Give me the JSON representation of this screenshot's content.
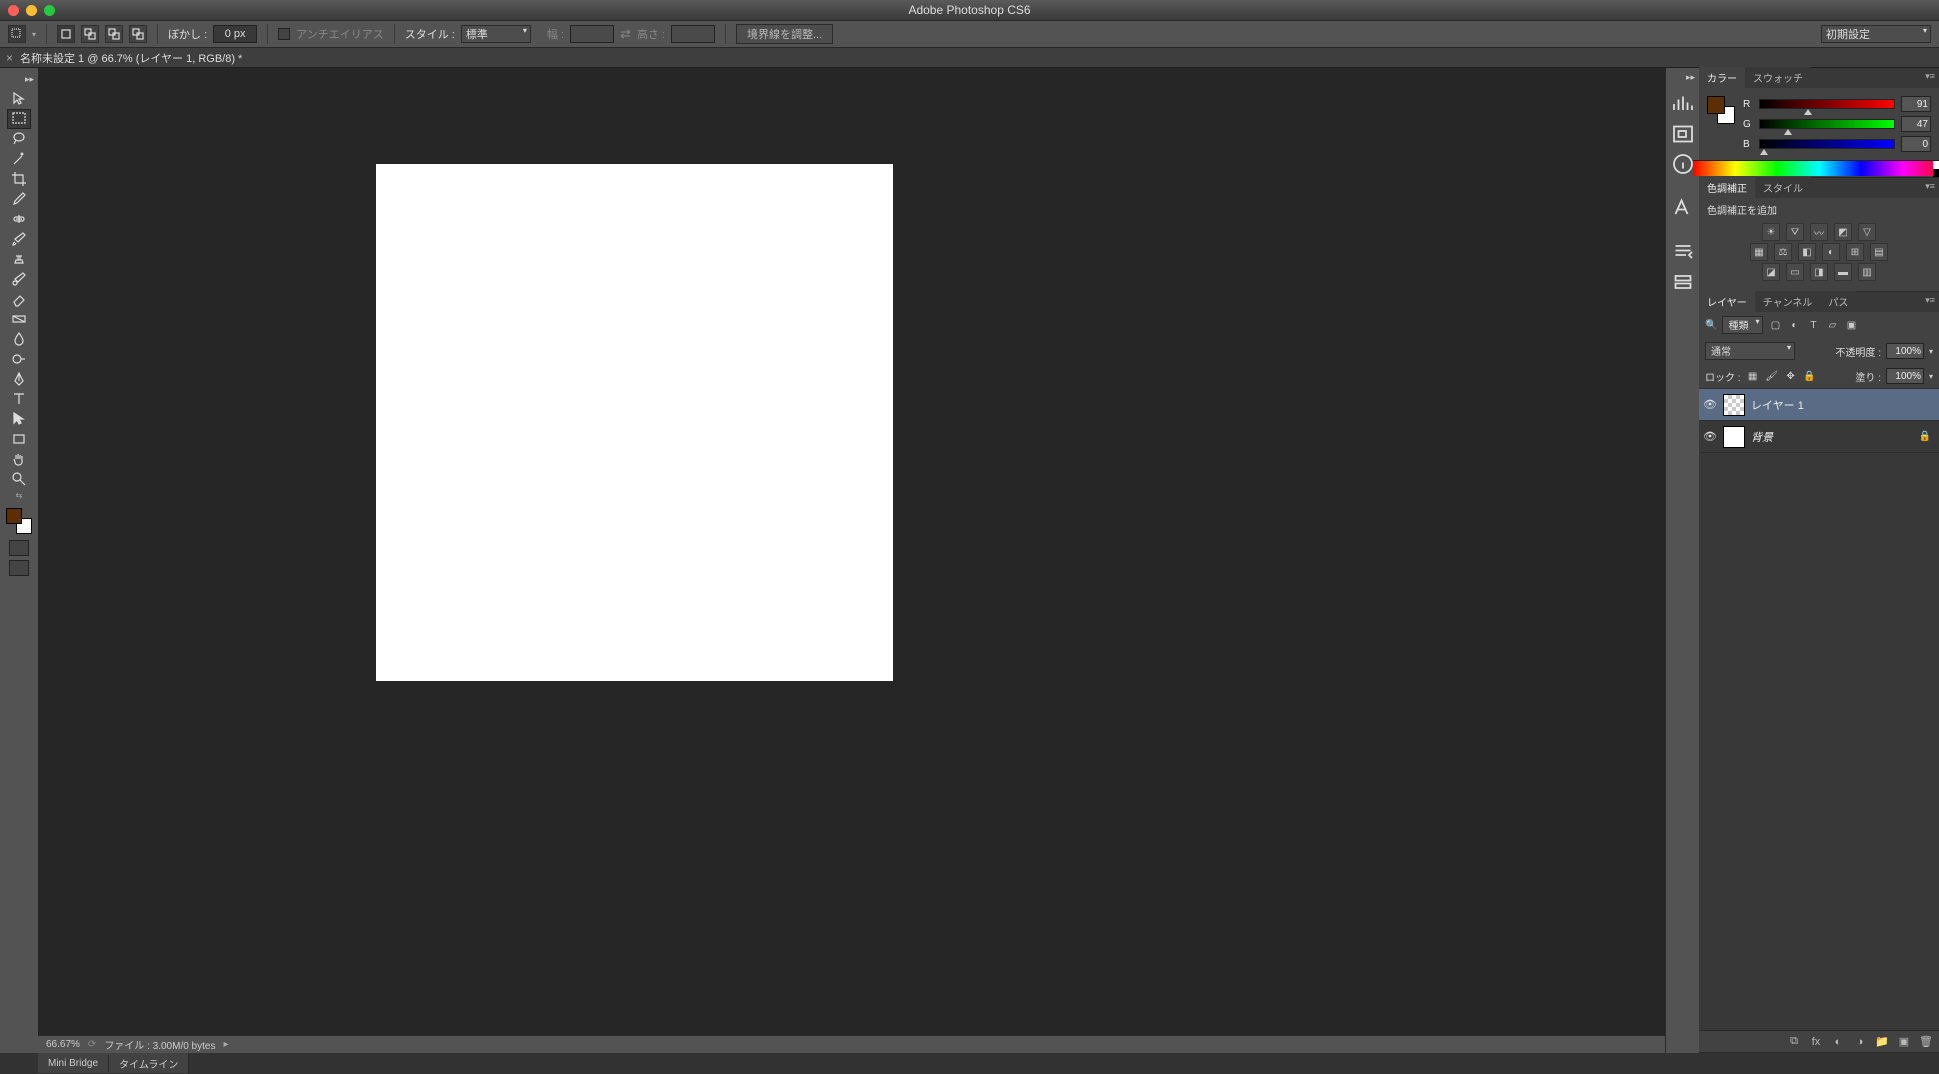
{
  "app_title": "Adobe Photoshop CS6",
  "workspace": "初期設定",
  "options_bar": {
    "feather_label": "ぼかし :",
    "feather_value": "0 px",
    "antialias_label": "アンチエイリアス",
    "style_label": "スタイル :",
    "style_value": "標準",
    "width_label": "幅 :",
    "height_label": "高さ :",
    "refine_edge": "境界線を調整..."
  },
  "doc_tab": {
    "title": "名称未設定 1 @ 66.7% (レイヤー 1, RGB/8) *"
  },
  "status": {
    "zoom": "66.67%",
    "file_info": "ファイル : 3.00M/0 bytes"
  },
  "bottom": {
    "mini_bridge": "Mini Bridge",
    "timeline": "タイムライン"
  },
  "color_panel": {
    "tab_color": "カラー",
    "tab_swatches": "スウォッチ",
    "r_label": "R",
    "r_value": "91",
    "g_label": "G",
    "g_value": "47",
    "b_label": "B",
    "b_value": "0",
    "fg_color": "#5b2f00"
  },
  "adjustments_panel": {
    "tab_adj": "色調補正",
    "tab_styles": "スタイル",
    "add_label": "色調補正を追加"
  },
  "layers_panel": {
    "tab_layers": "レイヤー",
    "tab_channels": "チャンネル",
    "tab_paths": "パス",
    "filter_label": "種類",
    "blend_mode": "通常",
    "opacity_label": "不透明度 :",
    "opacity_value": "100%",
    "lock_label": "ロック :",
    "fill_label": "塗り :",
    "fill_value": "100%",
    "layers": [
      {
        "name": "レイヤー 1",
        "locked": false,
        "transparent": true,
        "selected": true
      },
      {
        "name": "背景",
        "locked": true,
        "transparent": false,
        "selected": false
      }
    ]
  }
}
